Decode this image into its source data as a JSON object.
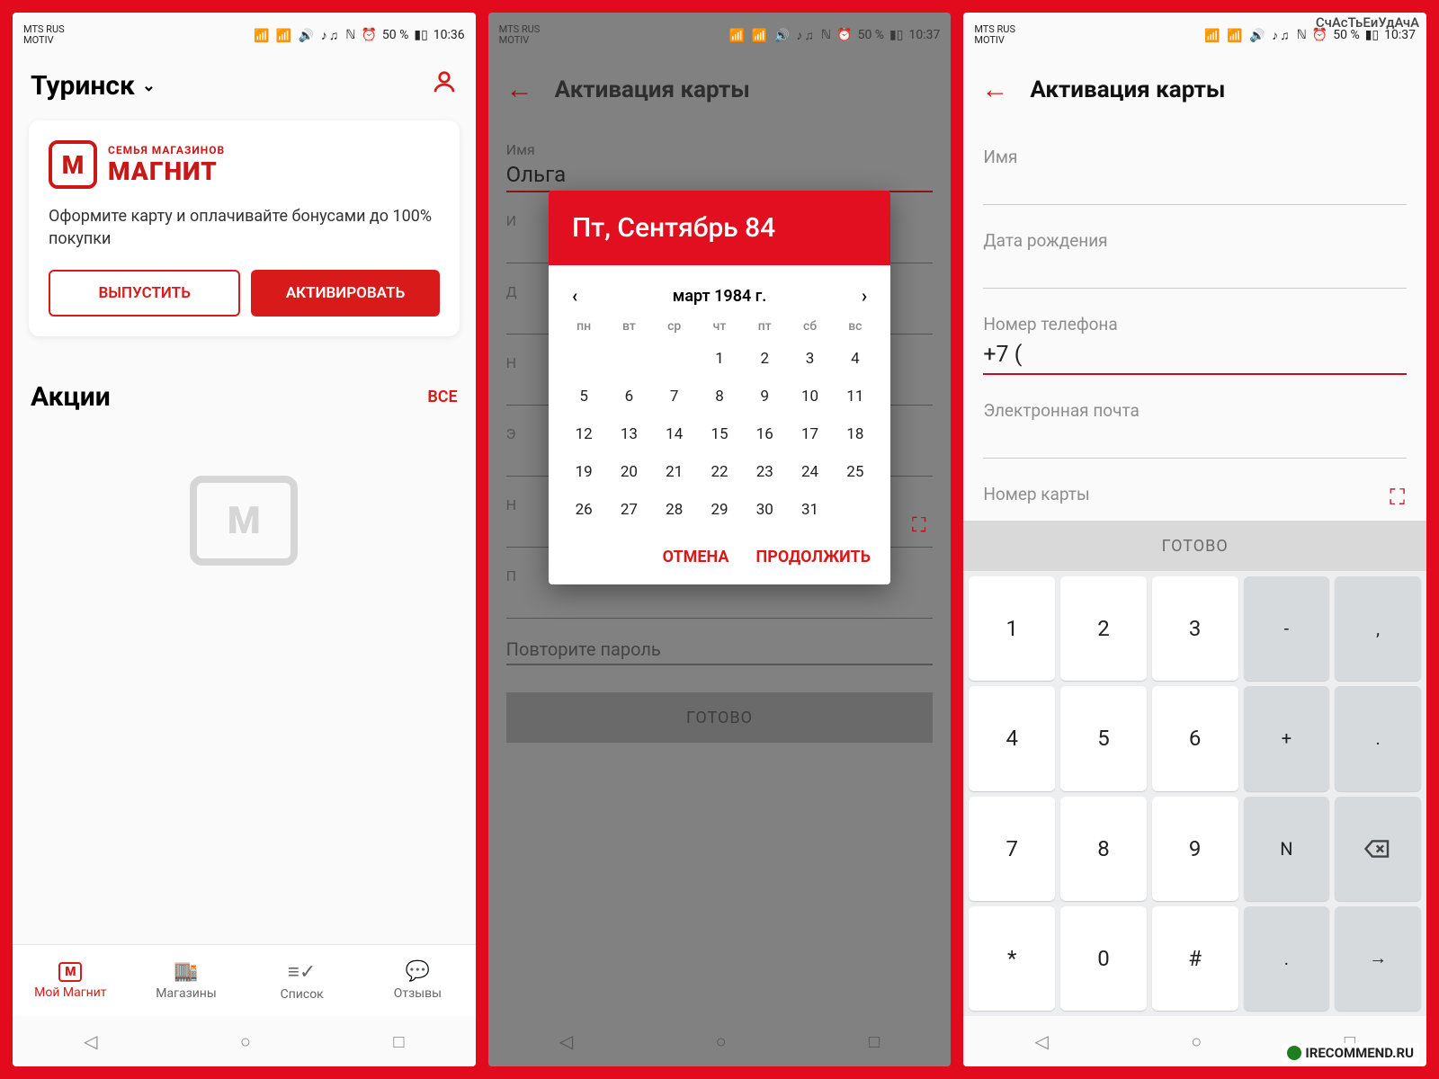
{
  "watermark": "СчАсТьЕиУдАчА",
  "source_site": "IRECOMMEND.RU",
  "statusbar": {
    "carrier1": "MTS RUS",
    "carrier2": "MOTIV",
    "nfc": "ℕ",
    "alarm": "⏰",
    "battery": "50 %",
    "time1": "10:36",
    "time2": "10:37",
    "time3": "10:37"
  },
  "screen1": {
    "city": "Туринск",
    "brand_sub": "СЕМЬЯ МАГАЗИНОВ",
    "brand_main": "МАГНИТ",
    "brand_glyph": "М",
    "card_desc": "Оформите карту и оплачивайте бонусами до 100% покупки",
    "btn_issue": "ВЫПУСТИТЬ",
    "btn_activate": "АКТИВИРОВАТЬ",
    "promo_title": "Акции",
    "promo_all": "ВСЕ",
    "nav": [
      {
        "icon": "М",
        "label": "Мой Магнит"
      },
      {
        "icon": "🏬",
        "label": "Магазины"
      },
      {
        "icon": "≡✓",
        "label": "Список"
      },
      {
        "icon": "💬",
        "label": "Отзывы"
      }
    ]
  },
  "screen2": {
    "title": "Активация карты",
    "fields": {
      "name_label": "Имя",
      "name_value": "Ольга",
      "ready": "ГОТОВО",
      "repeat_pwd": "Повторите пароль"
    },
    "datepicker": {
      "header": "Пт, Сентябрь 84",
      "month": "март 1984 г.",
      "dow": [
        "пн",
        "вт",
        "ср",
        "чт",
        "пт",
        "сб",
        "вс"
      ],
      "leading_blanks": 3,
      "days": 31,
      "cancel": "ОТМЕНА",
      "continue": "ПРОДОЛЖИТЬ"
    }
  },
  "screen3": {
    "title": "Активация карты",
    "fields": {
      "name": "Имя",
      "dob": "Дата рождения",
      "phone_label": "Номер телефона",
      "phone_value": "+7 (",
      "email": "Электронная почта",
      "card_no": "Номер карты"
    },
    "ready": "ГОТОВО",
    "keypad": [
      [
        "1",
        "2",
        "3",
        "-",
        ","
      ],
      [
        "4",
        "5",
        "6",
        "+",
        "."
      ],
      [
        "7",
        "8",
        "9",
        "N",
        "⌫"
      ],
      [
        "*",
        "0",
        "#",
        ".",
        "→"
      ]
    ],
    "keypad_fn_cols": [
      3,
      4
    ]
  },
  "sysnav": {
    "back": "◁",
    "home": "○",
    "recent": "□"
  }
}
